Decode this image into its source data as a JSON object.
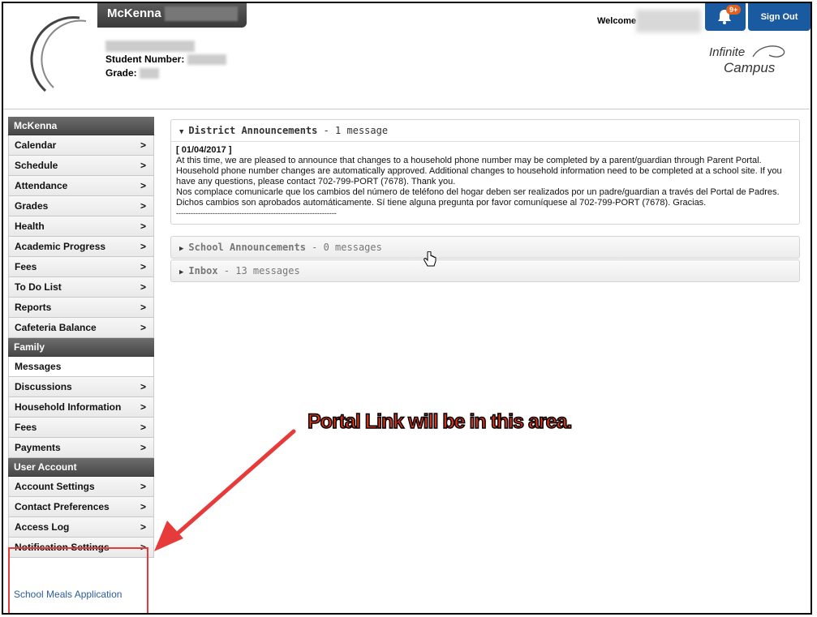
{
  "header": {
    "student_first_name": "McKenna",
    "student_number_label": "Student Number:",
    "grade_label": "Grade:",
    "welcome_label": "Welcome",
    "notification_badge": "9+",
    "sign_out_label": "Sign Out",
    "logo_line1": "Infinite",
    "logo_line2": "Campus"
  },
  "sidebar": {
    "sections": [
      {
        "title": "McKenna"
      },
      {
        "title": "Family"
      },
      {
        "title": "User Account"
      }
    ],
    "student_items": [
      "Calendar",
      "Schedule",
      "Attendance",
      "Grades",
      "Health",
      "Academic Progress",
      "Fees",
      "To Do List",
      "Reports",
      "Cafeteria Balance"
    ],
    "family_items": [
      "Messages",
      "Discussions",
      "Household Information",
      "Fees",
      "Payments"
    ],
    "account_items": [
      "Account Settings",
      "Contact Preferences",
      "Access Log",
      "Notification Settings"
    ],
    "extra_link": "School Meals Application"
  },
  "main": {
    "district": {
      "title": "District Announcements",
      "count": " - 1 message",
      "date": "[ 01/04/2017 ]",
      "body_en": "At this time, we are pleased to announce that changes to a household phone number may be completed by a parent/guardian through Parent Portal.  Household phone number changes are automatically approved.  Additional changes to household information need to be completed at a school site. If you have any questions, please contact 702-799-PORT (7678). Thank you.",
      "body_es": "Nos complace comunicarle que los cambios del número de teléfono del hogar deben ser realizados por un padre/guardian a través del Portal de Padres. Dichos cambios son aprobados automáticamente. Sí tiene alguna pregunta por favor comuníquese al 702-799-PORT (7678). Gracias.",
      "divider": "------------------------------------------------------------------"
    },
    "school": {
      "title": "School Announcements",
      "count": " - 0 messages"
    },
    "inbox": {
      "title": "Inbox",
      "count": " - 13 messages"
    }
  },
  "annotation": {
    "text": "Portal Link will be in this area."
  },
  "colors": {
    "accent_blue": "#1a5aa0",
    "annotation_red": "#e73b3b",
    "badge_orange": "#e2611f"
  }
}
